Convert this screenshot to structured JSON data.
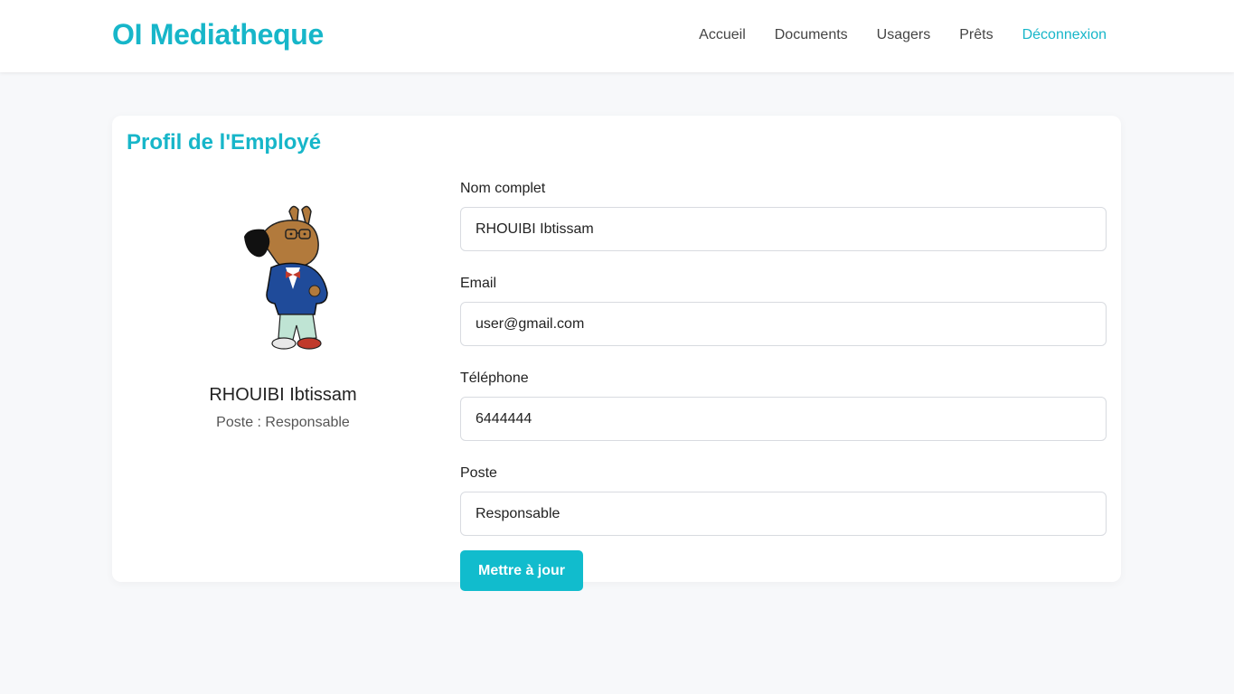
{
  "header": {
    "brand": "OI Mediatheque",
    "nav": [
      {
        "label": "Accueil"
      },
      {
        "label": "Documents"
      },
      {
        "label": "Usagers"
      },
      {
        "label": "Prêts"
      },
      {
        "label": "Déconnexion"
      }
    ]
  },
  "profile": {
    "title": "Profil de l'Employé",
    "name": "RHOUIBI Ibtissam",
    "role_line": "Poste : Responsable",
    "avatar_icon": "cartoon-dog-avatar"
  },
  "form": {
    "fields": [
      {
        "label": "Nom complet",
        "value": "RHOUIBI Ibtissam"
      },
      {
        "label": "Email",
        "value": "user@gmail.com"
      },
      {
        "label": "Téléphone",
        "value": "6444444"
      },
      {
        "label": "Poste",
        "value": "Responsable"
      }
    ],
    "submit_label": "Mettre à jour"
  },
  "colors": {
    "accent": "#17b6c9",
    "button": "#11bccd",
    "background": "#f7f8fa"
  }
}
